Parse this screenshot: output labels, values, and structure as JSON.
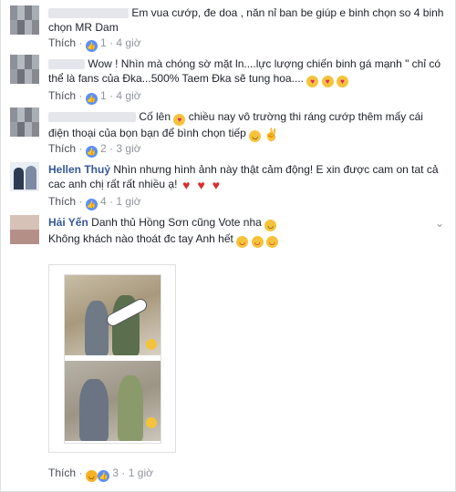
{
  "comments": [
    {
      "text": "Em vua cướp, đe doa , năn nỉ ban be giúp e binh chọn so 4 binh chọn MR Dam",
      "like_label": "Thích",
      "reaction_count": "1",
      "time": "4 giờ"
    },
    {
      "text": "Wow ! Nhìn mà chóng sờ mặt ln....lực lượng chiến binh gá mạnh \" chỉ có thể là fans của Đka...500% Taem Đka sẽ tung hoa....",
      "like_label": "Thích",
      "reaction_count": "1",
      "time": "4 giờ"
    },
    {
      "text": "Cố lên",
      "text_after": "chiều nay vô trường thi ráng cướp thêm mấy cái điện thoại của bọn bạn để bình chọn tiếp",
      "like_label": "Thích",
      "reaction_count": "2",
      "time": "3 giờ"
    },
    {
      "name": "Hellen Thuỷ",
      "text": "Nhìn nhưng hình ảnh này thật cảm động! E xin được cam on tat cả cac anh chị rất rất nhiều ạ!",
      "like_label": "Thích",
      "reaction_count": "4",
      "time": "1 giờ"
    },
    {
      "name": "Hải Yến",
      "text": "Danh thủ Hồng Sơn cũng Vote nha",
      "text_line2": "Không khách nào thoát đc tay Anh hết",
      "like_label": "Thích",
      "reaction_count": "3",
      "time": "1 giờ"
    }
  ],
  "separator": "·",
  "colors": {
    "link": "#365899",
    "meta": "#90949c",
    "like_reaction": "#5890ff",
    "haha_reaction": "#f7b125",
    "heart": "#d62e2e"
  },
  "icons": [
    "like-icon",
    "haha-icon",
    "heart-eyes-emoji",
    "grin-emoji",
    "victory-hand-emoji",
    "red-heart-emoji",
    "smirk-emoji",
    "tongue-wink-emoji",
    "chevron-down-icon"
  ]
}
